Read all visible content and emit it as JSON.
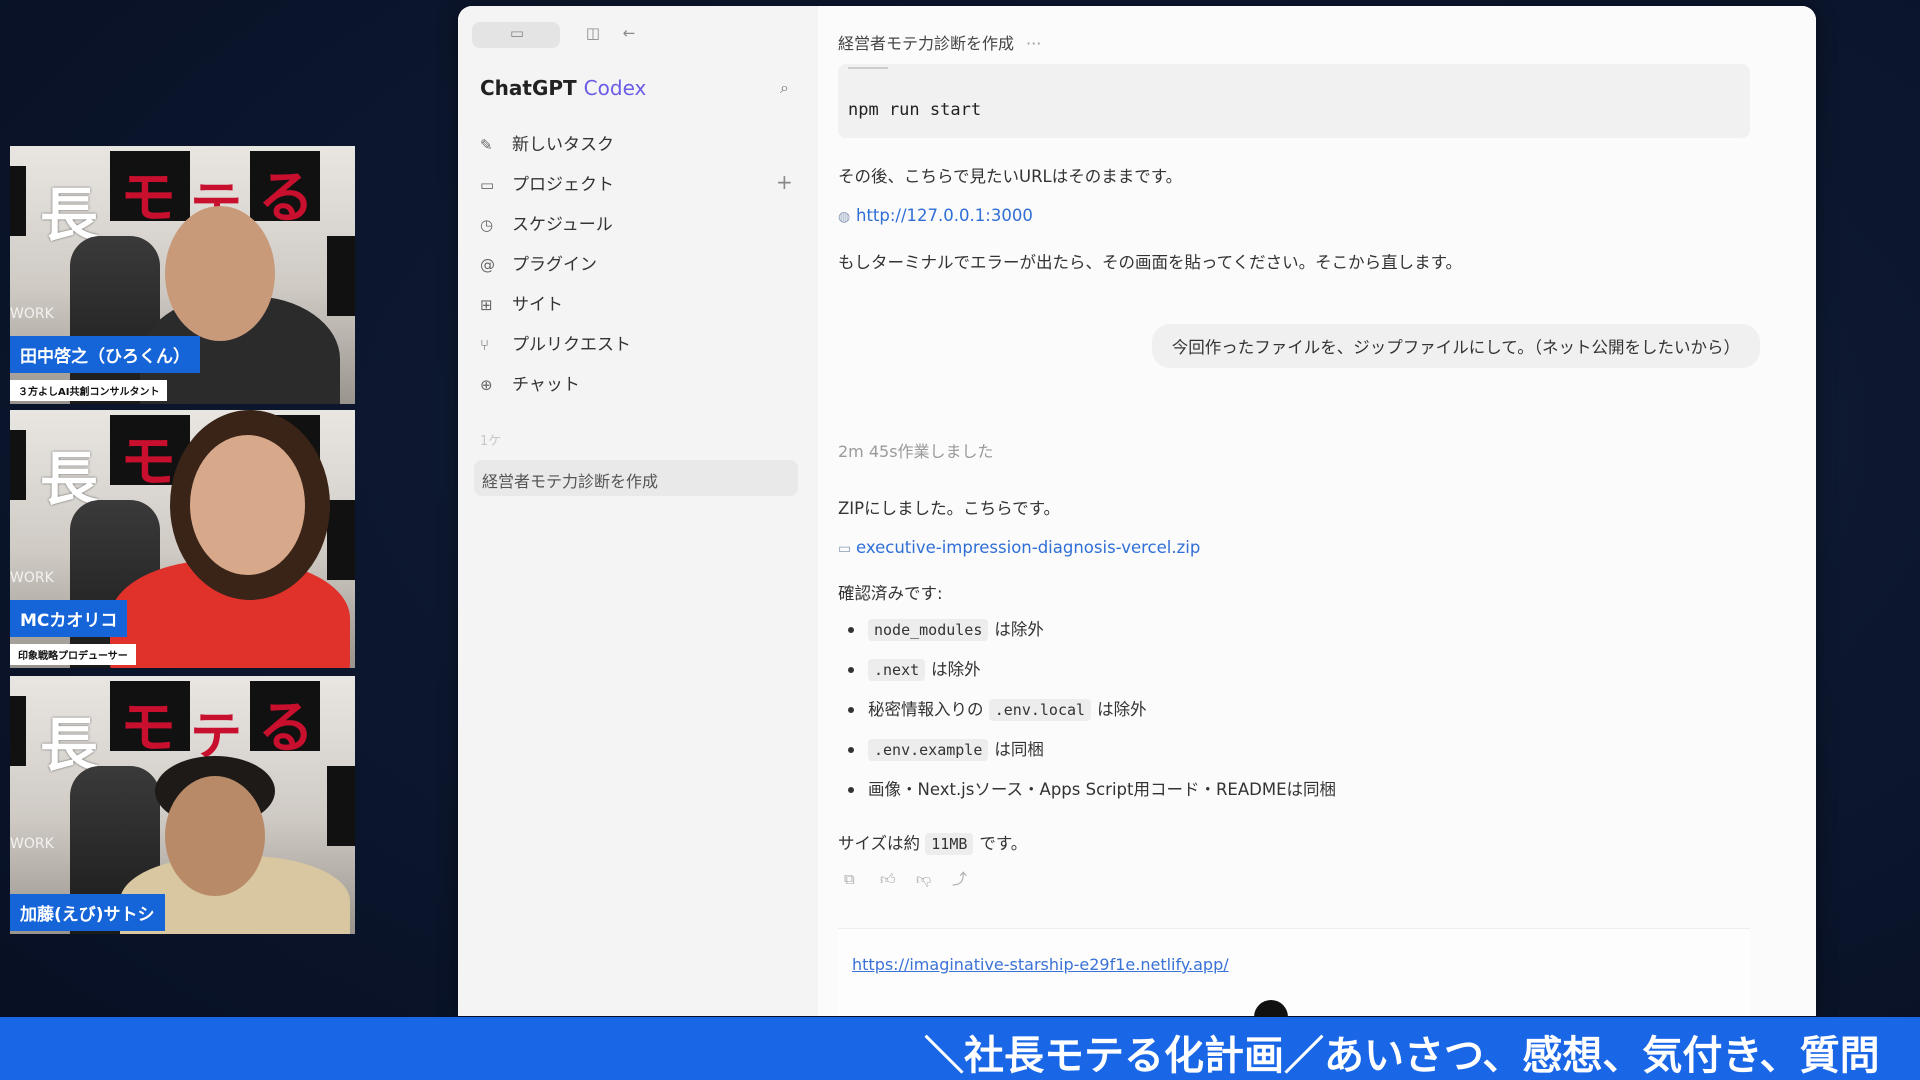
{
  "participants": [
    {
      "name": "田中啓之（ひろくん）",
      "title": "３方よしAI共創コンサルタント"
    },
    {
      "name": "MCカオリコ",
      "title": "印象戦略プロデューサー"
    },
    {
      "name": "加藤(えび)サトシ",
      "title": ""
    }
  ],
  "backdrop": {
    "chars": [
      "長",
      "モ",
      "テ",
      "る"
    ],
    "work": "WORK"
  },
  "app": {
    "brand_main": "ChatGPT",
    "brand_sub": "Codex",
    "nav": [
      {
        "icon": "edit-icon",
        "glyph": "✎",
        "label": "新しいタスク"
      },
      {
        "icon": "folder-icon",
        "glyph": "▭",
        "label": "プロジェクト"
      },
      {
        "icon": "clock-icon",
        "glyph": "◷",
        "label": "スケジュール"
      },
      {
        "icon": "at-icon",
        "glyph": "@",
        "label": "プラグイン"
      },
      {
        "icon": "grid-icon",
        "glyph": "⊞",
        "label": "サイト"
      },
      {
        "icon": "pull-request-icon",
        "glyph": "⑂",
        "label": "プルリクエスト"
      },
      {
        "icon": "plus-circle-icon",
        "glyph": "⊕",
        "label": "チャット"
      }
    ],
    "faint_label": "1ケ",
    "active_task": "経営者モテ力診断を作成",
    "conversation_title": "経営者モテ力診断を作成",
    "title_menu": "···"
  },
  "chat": {
    "code": "npm run start",
    "p1": "その後、こちらで見たいURLはそのままです。",
    "url": "http://127.0.0.1:3000",
    "p2": "もしターミナルでエラーが出たら、その画面を貼ってください。そこから直します。",
    "user_message": "今回作ったファイルを、ジップファイルにして。（ネット公開をしたいから）",
    "worked": "2m 45s作業しました",
    "p3": "ZIPにしました。こちらです。",
    "zip": "executive-impression-diagnosis-vercel.zip",
    "confirmed": "確認済みです:",
    "bullets": [
      {
        "code": "node_modules",
        "text": "は除外"
      },
      {
        "code": ".next",
        "text": "は除外"
      },
      {
        "pre": "秘密情報入りの",
        "code": ".env.local",
        "text": "は除外"
      },
      {
        "code": ".env.example",
        "text": "は同梱"
      },
      {
        "text": "画像・Next.jsソース・Apps Script用コード・READMEは同梱"
      }
    ],
    "size_pre": "サイズは約",
    "size_code": "11MB",
    "size_post": "です。",
    "input_link": "https://imaginative-starship-e29f1e.netlify.app/"
  },
  "ticker": "＼社長モテる化計画／あいさつ、感想、気付き、質問"
}
